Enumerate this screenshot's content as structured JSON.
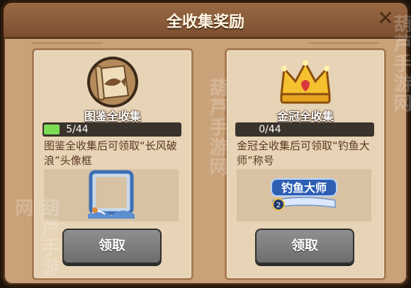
{
  "dialog": {
    "title": "全收集奖励",
    "close_glyph": "✕"
  },
  "cards": [
    {
      "name": "图鉴全收集",
      "progress_text": "5/44",
      "progress_fraction": 0.114,
      "description": "图鉴全收集后可领取“长风破浪”头像框",
      "icon": "scroll-fish-icon",
      "claim_label": "领取"
    },
    {
      "name": "金冠全收集",
      "progress_text": "0/44",
      "progress_fraction": 0.0,
      "description": "金冠全收集后可领取“钓鱼大师”称号",
      "icon": "golden-crown-icon",
      "claim_label": "领取",
      "title_badge_text": "钓鱼大师",
      "title_badge_level": "2"
    }
  ],
  "watermark": [
    "葫芦手游网",
    "葫芦手游网",
    "葫芦手游网"
  ],
  "colors": {
    "panel": "#caa27a",
    "card": "#e7d3b5",
    "progress_fill": "#7bdc54",
    "button": "#7d7d7d"
  }
}
